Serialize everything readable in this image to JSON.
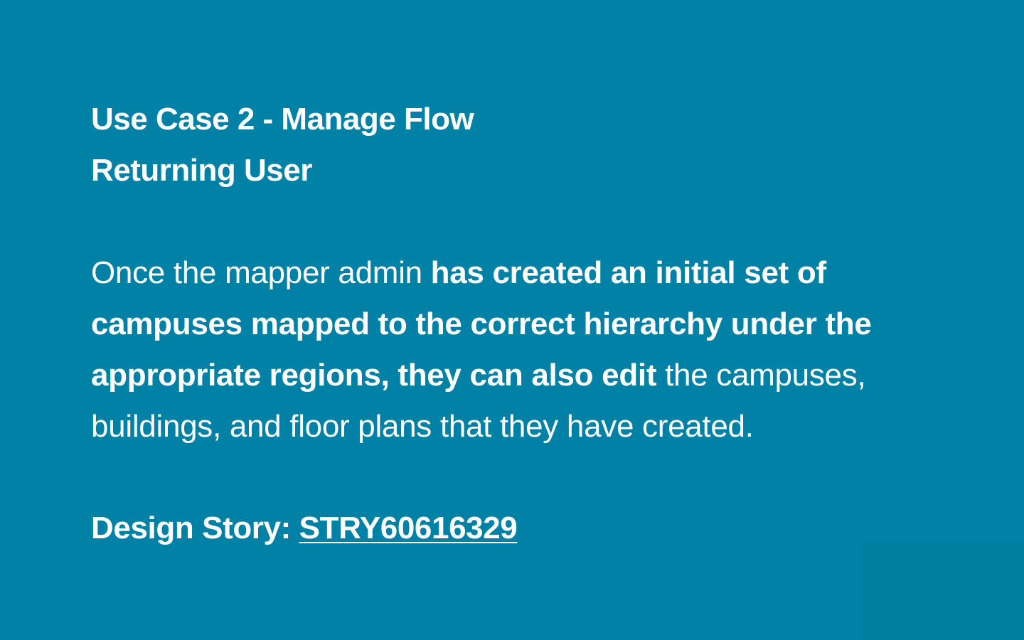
{
  "title": {
    "line1": "Use Case 2 - Manage Flow",
    "line2": "Returning User"
  },
  "body": {
    "part1": "Once the mapper admin ",
    "part2_bold": "has created an initial set of campuses mapped to the correct hierarchy under the appropriate regions, they can also edit",
    "part3": " the campuses, buildings, and floor plans that they have created."
  },
  "footer": {
    "label": "Design Story:",
    "link": "STRY60616329"
  },
  "colors": {
    "background": "#0081a5",
    "corner_block": "#007ea0",
    "text": "#ffffff"
  }
}
